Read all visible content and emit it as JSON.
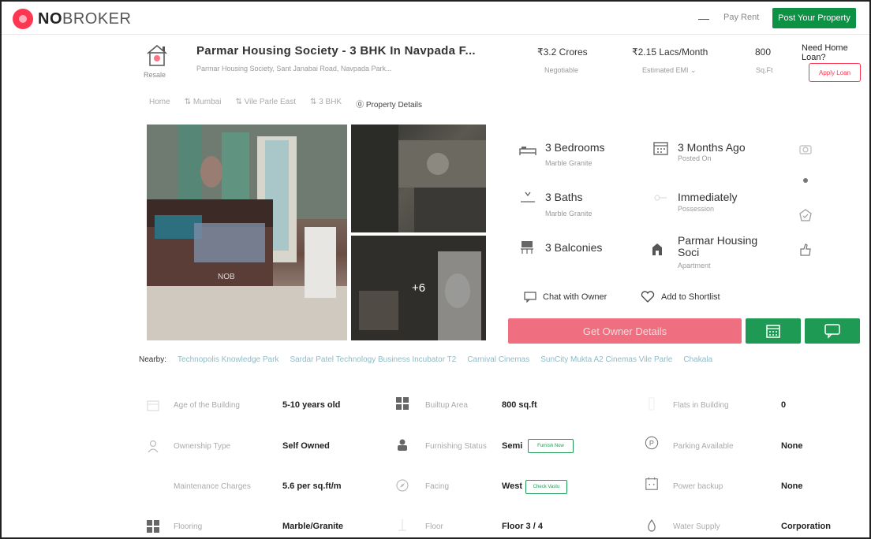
{
  "header": {
    "logo_bold": "NO",
    "logo_rest": "BROKER",
    "dash": "—",
    "pay_rent": "Pay Rent",
    "post_property": "Post Your Property",
    "colors": {
      "brand": "#fd3752",
      "green": "#0d9144"
    }
  },
  "summary": {
    "type_label": "Resale",
    "title": "Parmar Housing Society - 3 BHK In Navpada F...",
    "subtitle": "Parmar Housing Society, Sant Janabai Road, Navpada Park...",
    "price": "₹3.2 Crores",
    "price_note": "Negotiable",
    "emi": "₹2.15 Lacs/Month",
    "emi_note": "Estimated EMI ⌄",
    "area": "800",
    "area_unit": "Sq.Ft",
    "loan_title": "Need Home Loan?",
    "loan_button": "Apply Loan"
  },
  "breadcrumb": [
    "Home",
    "Mumbai",
    "Vile Parle East",
    "3 BHK",
    "Property Details"
  ],
  "gallery": {
    "watermark": "NOB",
    "more_count": "+6"
  },
  "features": [
    {
      "title": "3 Bedrooms",
      "sub": "Marble Granite",
      "icon": "bed-icon"
    },
    {
      "title": "3 Months Ago",
      "sub": "Posted On",
      "icon": "calendar-icon"
    },
    {
      "title": "3 Baths",
      "sub": "Marble Granite",
      "icon": "bath-icon"
    },
    {
      "title": "Immediately",
      "sub": "Possession",
      "icon": "key-icon"
    },
    {
      "title": "3 Balconies",
      "sub": "",
      "icon": "balcony-icon"
    },
    {
      "title": "Parmar Housing Soci",
      "sub": "Apartment",
      "icon": "building-icon"
    }
  ],
  "actions": {
    "chat_owner": "Chat with Owner",
    "shortlist": "Add to Shortlist",
    "owner_details": "Get Owner Details"
  },
  "nearby": {
    "label": "Nearby:",
    "items": [
      "Technopolis Knowledge Park",
      "Sardar Patel Technology Business Incubator T2",
      "Carnival Cinemas",
      "SunCity Mukta A2 Cinemas Vile Parle",
      "Chakala"
    ]
  },
  "details": [
    {
      "label": "Age of the Building",
      "value": "5-10 years old",
      "icon": "building-age-icon"
    },
    {
      "label": "Builtup Area",
      "value": "800 sq.ft",
      "icon": "grid-icon"
    },
    {
      "label": "Flats in Building",
      "value": "0",
      "icon": "flats-icon"
    },
    {
      "label": "Ownership Type",
      "value": "Self Owned",
      "icon": "owner-icon"
    },
    {
      "label": "Furnishing Status",
      "value": "Semi",
      "tag": "Furnish Now",
      "icon": "sofa-icon"
    },
    {
      "label": "Parking Available",
      "value": "None",
      "icon": "parking-icon"
    },
    {
      "label": "Maintenance Charges",
      "value": "5.6 per sq.ft/m",
      "icon": "maintenance-icon"
    },
    {
      "label": "Facing",
      "value": "West",
      "tag": "Check Vastu",
      "icon": "compass-icon"
    },
    {
      "label": "Power backup",
      "value": "None",
      "icon": "power-icon"
    },
    {
      "label": "Flooring",
      "value": "Marble/Granite",
      "icon": "flooring-icon"
    },
    {
      "label": "Floor",
      "value": "Floor 3 / 4",
      "icon": "floor-icon"
    },
    {
      "label": "Water Supply",
      "value": "Corporation",
      "icon": "water-icon"
    }
  ]
}
